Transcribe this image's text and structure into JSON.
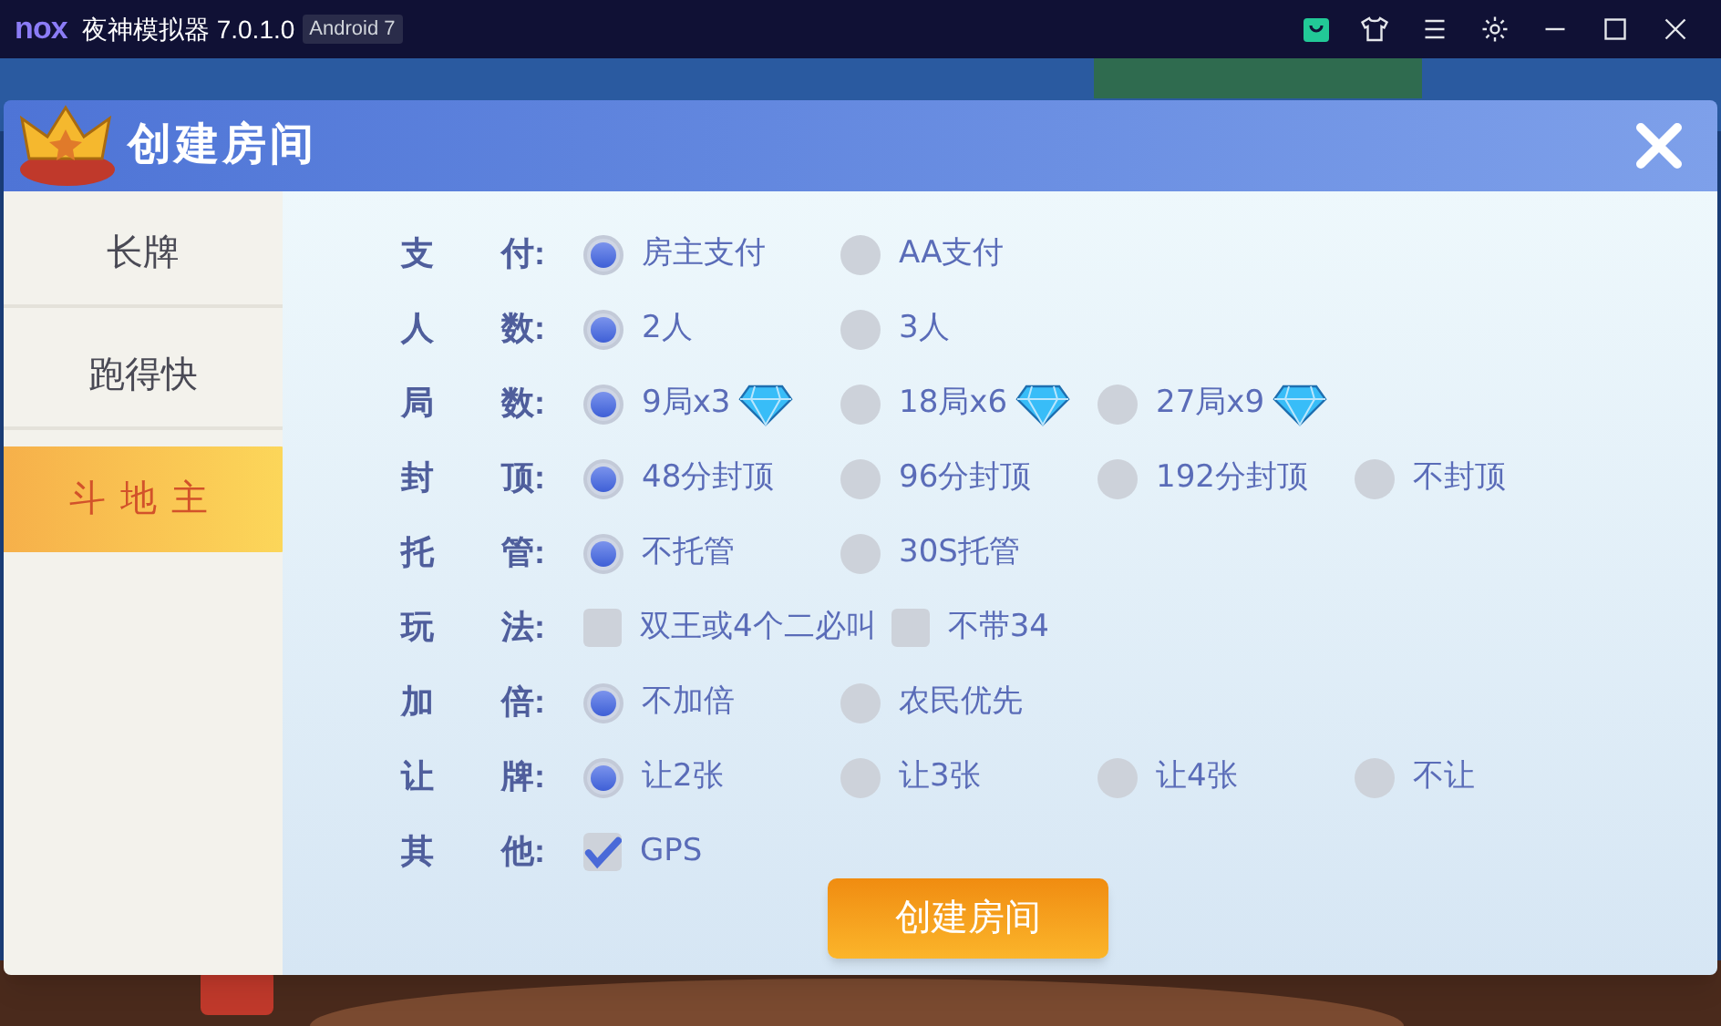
{
  "window": {
    "logo": "nox",
    "title": "夜神模拟器 7.0.1.0",
    "badge": "Android 7"
  },
  "dialog": {
    "title": "创建房间",
    "submit": "创建房间"
  },
  "sidebar": {
    "items": [
      {
        "label": "长牌",
        "selected": false
      },
      {
        "label": "跑得快",
        "selected": false
      },
      {
        "label": "斗地主",
        "selected": true
      }
    ]
  },
  "rows": [
    {
      "label": "支",
      "label_end": "付:",
      "options": [
        {
          "kind": "radio",
          "text": "房主支付",
          "selected": true
        },
        {
          "kind": "radio",
          "text": "AA支付",
          "selected": false
        }
      ]
    },
    {
      "label": "人",
      "label_end": "数:",
      "options": [
        {
          "kind": "radio",
          "text": "2人",
          "selected": true
        },
        {
          "kind": "radio",
          "text": "3人",
          "selected": false
        }
      ]
    },
    {
      "label": "局",
      "label_end": "数:",
      "options": [
        {
          "kind": "radio",
          "text": "9局x3",
          "selected": true,
          "gem": true
        },
        {
          "kind": "radio",
          "text": "18局x6",
          "selected": false,
          "gem": true
        },
        {
          "kind": "radio",
          "text": "27局x9",
          "selected": false,
          "gem": true
        }
      ]
    },
    {
      "label": "封",
      "label_end": "顶:",
      "options": [
        {
          "kind": "radio",
          "text": "48分封顶",
          "selected": true
        },
        {
          "kind": "radio",
          "text": "96分封顶",
          "selected": false
        },
        {
          "kind": "radio",
          "text": "192分封顶",
          "selected": false
        },
        {
          "kind": "radio",
          "text": "不封顶",
          "selected": false
        }
      ]
    },
    {
      "label": "托",
      "label_end": "管:",
      "options": [
        {
          "kind": "radio",
          "text": "不托管",
          "selected": true
        },
        {
          "kind": "radio",
          "text": "30S托管",
          "selected": false
        }
      ]
    },
    {
      "label": "玩",
      "label_end": "法:",
      "options": [
        {
          "kind": "checkbox",
          "text": "双王或4个二必叫",
          "checked": false
        },
        {
          "kind": "checkbox",
          "text": "不带34",
          "checked": false
        }
      ]
    },
    {
      "label": "加",
      "label_end": "倍:",
      "options": [
        {
          "kind": "radio",
          "text": "不加倍",
          "selected": true
        },
        {
          "kind": "radio",
          "text": "农民优先",
          "selected": false
        }
      ]
    },
    {
      "label": "让",
      "label_end": "牌:",
      "options": [
        {
          "kind": "radio",
          "text": "让2张",
          "selected": true
        },
        {
          "kind": "radio",
          "text": "让3张",
          "selected": false
        },
        {
          "kind": "radio",
          "text": "让4张",
          "selected": false
        },
        {
          "kind": "radio",
          "text": "不让",
          "selected": false
        }
      ]
    },
    {
      "label": "其",
      "label_end": "他:",
      "options": [
        {
          "kind": "checkbox",
          "text": "GPS",
          "checked": true
        }
      ]
    }
  ]
}
